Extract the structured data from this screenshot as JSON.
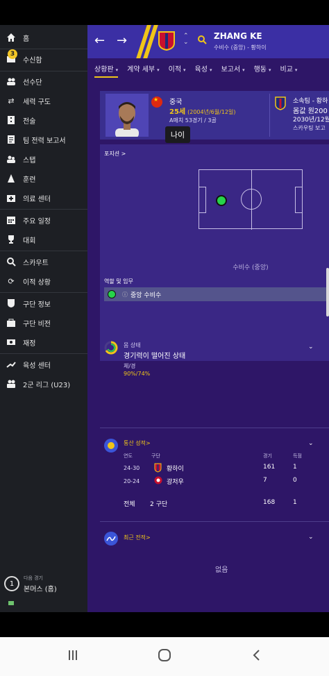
{
  "sidebar": {
    "items": [
      {
        "label": "홈",
        "icon": "home-icon"
      },
      {
        "label": "수신함",
        "icon": "inbox-icon",
        "badge": "3"
      },
      {
        "label": "선수단",
        "icon": "squad-icon"
      },
      {
        "label": "세력 구도",
        "icon": "dynamics-icon"
      },
      {
        "label": "전술",
        "icon": "tactics-icon"
      },
      {
        "label": "팀 전력 보고서",
        "icon": "report-icon"
      },
      {
        "label": "스탭",
        "icon": "staff-icon"
      },
      {
        "label": "훈련",
        "icon": "training-icon"
      },
      {
        "label": "의료 센터",
        "icon": "medical-icon"
      },
      {
        "label": "주요 일정",
        "icon": "calendar-icon"
      },
      {
        "label": "대회",
        "icon": "trophy-icon"
      },
      {
        "label": "스카우트",
        "icon": "scout-icon"
      },
      {
        "label": "이적 상황",
        "icon": "transfer-icon"
      },
      {
        "label": "구단 정보",
        "icon": "club-icon"
      },
      {
        "label": "구단 비전",
        "icon": "vision-icon"
      },
      {
        "label": "재정",
        "icon": "finance-icon"
      },
      {
        "label": "육성 센터",
        "icon": "development-icon"
      },
      {
        "label": "2군 리그 (U23)",
        "icon": "u23-icon"
      }
    ],
    "next_match": {
      "number": "1",
      "caption": "다음 경기",
      "value": "본머스 (홈)"
    }
  },
  "topbar": {
    "player_name": "ZHANG KE",
    "player_sub": "수비수 (중앙) - 황하이"
  },
  "tabs": [
    {
      "label": "상황판",
      "active": true
    },
    {
      "label": "계약 세부",
      "active": false
    },
    {
      "label": "이적",
      "active": false
    },
    {
      "label": "육성",
      "active": false
    },
    {
      "label": "보고서",
      "active": false
    },
    {
      "label": "행동",
      "active": false
    },
    {
      "label": "비교",
      "active": false
    }
  ],
  "profile": {
    "nation": "중국",
    "age": "25세",
    "dob": "(2004년/6월/12일)",
    "caps": "A매치 53경기 / 3골",
    "club_label": "소속팀 - 황하",
    "value": "몸값 원200",
    "contract": "2030년/12월",
    "scout": "스카우팅 보고"
  },
  "tooltip": "나이",
  "position": {
    "title": "포지션 >",
    "caption": "수비수 (중앙)",
    "roles_title": "역할 및 임무",
    "role": "중앙 수비수"
  },
  "condition": {
    "title": "몸 상태",
    "status": "경기력이 떨어진 상태",
    "sub_label": "체/경",
    "values": "90%/74%"
  },
  "stats": {
    "title": "통산 성적>",
    "headers": {
      "year": "연도",
      "club": "구단",
      "apps": "경기",
      "goals": "득점"
    },
    "rows": [
      {
        "year": "24-30",
        "club": "황하이",
        "apps": "161",
        "goals": "1"
      },
      {
        "year": "20-24",
        "club": "광저우",
        "apps": "7",
        "goals": "0"
      }
    ],
    "total": {
      "label": "전체",
      "clubs": "2 구단",
      "apps": "168",
      "goals": "1"
    }
  },
  "recent": {
    "title": "최근 전적>",
    "empty": "없음"
  },
  "colors": {
    "accent": "#f0c519",
    "main_bg": "#2e1667",
    "topbar": "#3b2fa4",
    "sidebar": "#1d1f24",
    "position_dot": "#27d34a"
  }
}
